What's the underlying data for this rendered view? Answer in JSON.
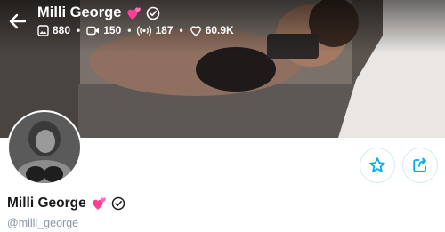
{
  "header": {
    "name": "Milli George",
    "stats": [
      {
        "icon": "image-icon",
        "value": "880"
      },
      {
        "icon": "video-icon",
        "value": "150"
      },
      {
        "icon": "stream-icon",
        "value": "187"
      },
      {
        "icon": "heart-icon",
        "value": "60.9K"
      }
    ],
    "stat_separator": "•"
  },
  "profile": {
    "name": "Milli George",
    "username": "@milli_george"
  },
  "colors": {
    "accent": "#00aff0",
    "hearts": "#ff3e9a",
    "muted": "#8a96a3",
    "button_border": "#d6e9f7"
  },
  "icons": {
    "back": "arrow-left-icon",
    "verified": "verified-check-icon",
    "badge": "two-hearts-icon",
    "favorite": "star-icon",
    "share": "share-icon"
  }
}
